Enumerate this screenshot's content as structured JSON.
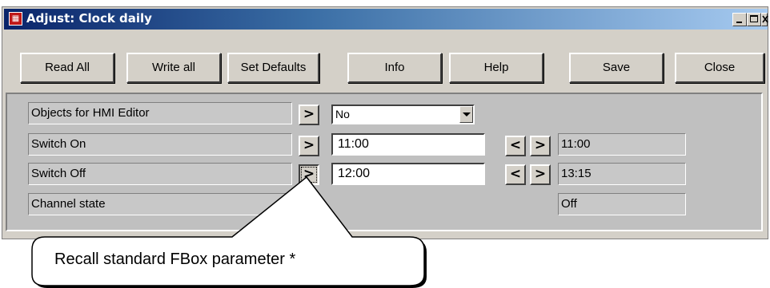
{
  "window": {
    "title": "Adjust: Clock daily",
    "app_icon": "function-box-icon",
    "controls": [
      "minimize-icon",
      "maximize-icon",
      "close-icon"
    ]
  },
  "toolbar": {
    "read_all": "Read All",
    "write_all": "Write all",
    "set_defaults": "Set Defaults",
    "info": "Info",
    "help": "Help",
    "save": "Save",
    "close": "Close"
  },
  "rows": [
    {
      "label": "Objects for HMI Editor",
      "recall": ">",
      "select_value": "No"
    },
    {
      "label": "Switch On",
      "recall": ">",
      "input_value": "11:00",
      "dec": "<",
      "inc": ">",
      "current": "11:00"
    },
    {
      "label": "Switch Off",
      "recall": ">",
      "input_value": "12:00",
      "dec": "<",
      "inc": ">",
      "current": "13:15"
    },
    {
      "label": "Channel state",
      "current": "Off"
    }
  ],
  "callout": {
    "text": "Recall standard FBox parameter *"
  }
}
